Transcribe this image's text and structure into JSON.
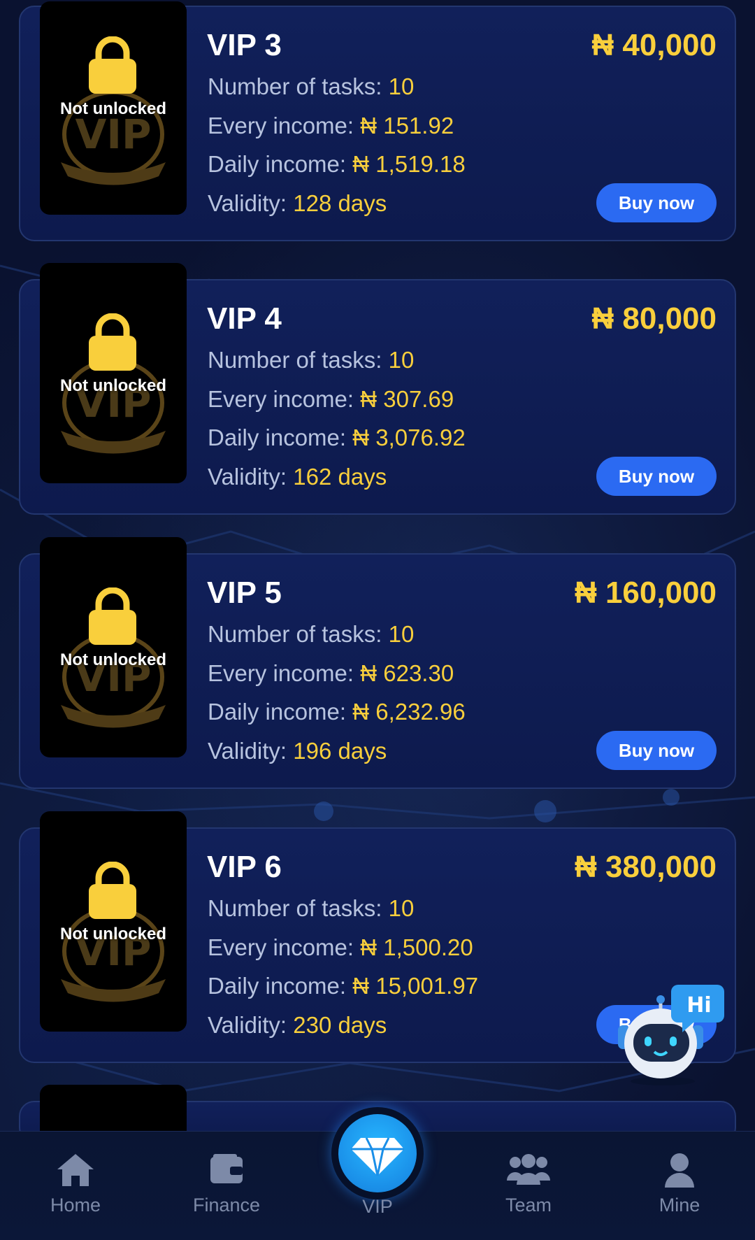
{
  "currency_symbol": "₦",
  "not_unlocked_label": "Not unlocked",
  "thumb_watermark": "VIP",
  "labels": {
    "tasks": "Number of tasks: ",
    "every_income": "Every income: ",
    "daily_income": "Daily income: ",
    "validity": "Validity: ",
    "buy": "Buy now"
  },
  "plans": [
    {
      "title": "VIP 3",
      "price": "₦ 40,000",
      "tasks": "10",
      "every_income": "₦ 151.92",
      "daily_income": "₦ 1,519.18",
      "validity": "128 days"
    },
    {
      "title": "VIP 4",
      "price": "₦ 80,000",
      "tasks": "10",
      "every_income": "₦ 307.69",
      "daily_income": "₦ 3,076.92",
      "validity": "162 days"
    },
    {
      "title": "VIP 5",
      "price": "₦ 160,000",
      "tasks": "10",
      "every_income": "₦ 623.30",
      "daily_income": "₦ 6,232.96",
      "validity": "196 days"
    },
    {
      "title": "VIP 6",
      "price": "₦ 380,000",
      "tasks": "10",
      "every_income": "₦ 1,500.20",
      "daily_income": "₦ 15,001.97",
      "validity": "230 days"
    }
  ],
  "assistant": {
    "bubble_text": "Hi"
  },
  "tabbar": {
    "home": "Home",
    "finance": "Finance",
    "vip": "VIP",
    "team": "Team",
    "mine": "Mine"
  },
  "colors": {
    "accent": "#f9cf3c",
    "button": "#2b6af2",
    "card": "#11205a",
    "background": "#0a1230",
    "vip_tab": "#1a8fe8"
  }
}
